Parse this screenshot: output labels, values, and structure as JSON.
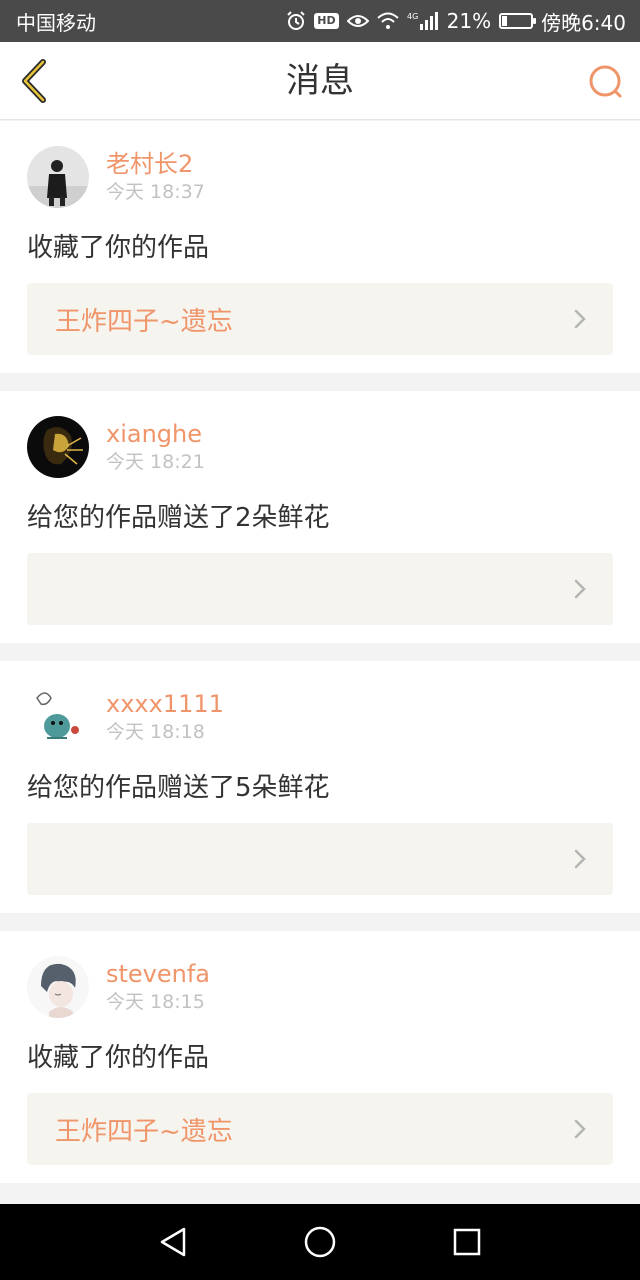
{
  "status_bar": {
    "carrier": "中国移动",
    "network": "4G",
    "battery": "21%",
    "battery_level": 0.21,
    "time": "傍晚6:40",
    "hd": "HD"
  },
  "nav": {
    "title": "消息",
    "accent_color": "#f0956a"
  },
  "messages": [
    {
      "username": "老村长2",
      "time": "今天 18:37",
      "action": "收藏了你的作品",
      "work_title": "王炸四子~遗忘"
    },
    {
      "username": "xianghe",
      "time": "今天 18:21",
      "action": "给您的作品赠送了2朵鲜花",
      "work_title": ""
    },
    {
      "username": "xxxx1111",
      "time": "今天 18:18",
      "action": "给您的作品赠送了5朵鲜花",
      "work_title": ""
    },
    {
      "username": "stevenfa",
      "time": "今天 18:15",
      "action": "收藏了你的作品",
      "work_title": "王炸四子~遗忘"
    }
  ]
}
